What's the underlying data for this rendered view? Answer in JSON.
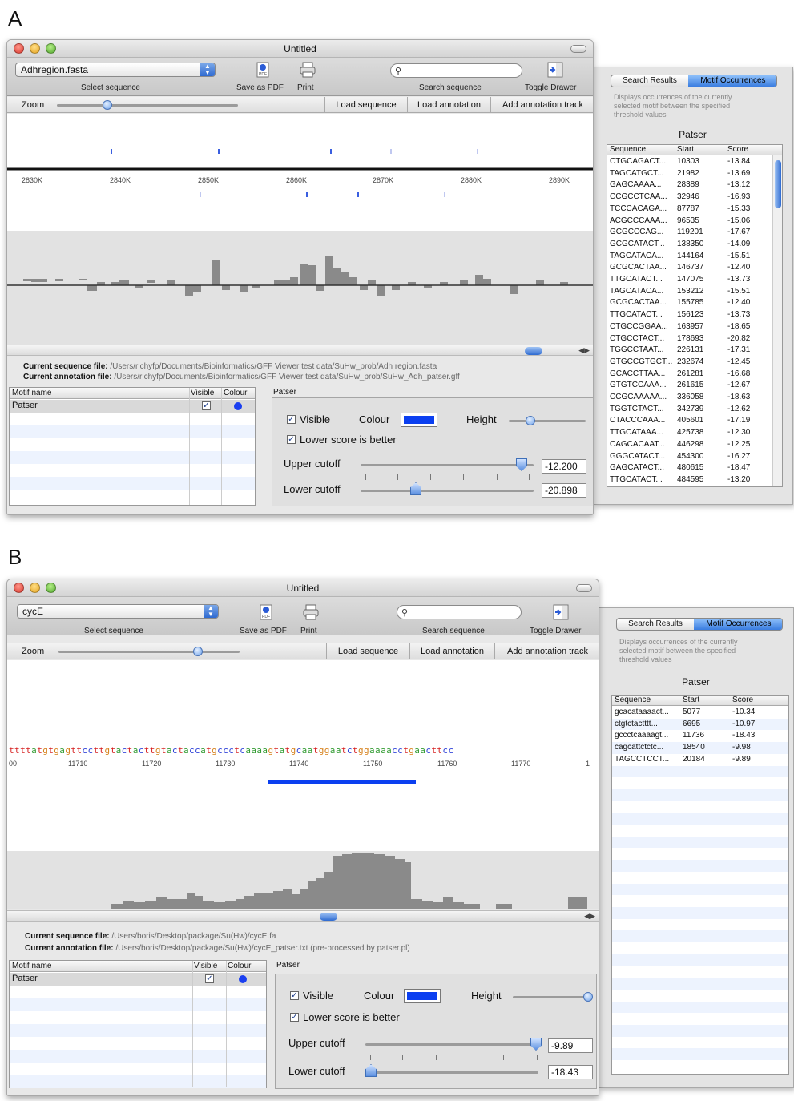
{
  "panel_labels": [
    "A",
    "B"
  ],
  "colors": {
    "motif_colour": "#0b3ff0",
    "track_tick": "#3a5fe0",
    "nuc_a": "#2f9a2f",
    "nuc_c": "#2c3fd8",
    "nuc_g": "#d6801a",
    "nuc_t": "#d62020"
  },
  "A": {
    "window_title": "Untitled",
    "sequence_select": "Adhregion.fasta",
    "select_sequence_label": "Select sequence",
    "save_pdf_label": "Save as PDF",
    "print_label": "Print",
    "search_label": "Search sequence",
    "toggle_drawer_label": "Toggle Drawer",
    "zoom_label": "Zoom",
    "zoom_level": 0.28,
    "load_sequence": "Load sequence",
    "load_annotation": "Load annotation",
    "add_track": "Add annotation track",
    "axis_ticks": [
      "2830K",
      "2840K",
      "2850K",
      "2860K",
      "2870K",
      "2880K",
      "2890K"
    ],
    "current_sequence_label": "Current sequence file:",
    "current_sequence_path": "/Users/richyfp/Documents/Bioinformatics/GFF Viewer test data/SuHw_prob/Adh region.fasta",
    "current_annotation_label": "Current annotation file:",
    "current_annotation_path": "/Users/richyfp/Documents/Bioinformatics/GFF Viewer test data/SuHw_prob/SuHw_Adh_patser.gff",
    "motif_headers": [
      "Motif name",
      "Visible",
      "Colour"
    ],
    "motif_rows": [
      {
        "name": "Patser"
      }
    ],
    "patser_title": "Patser",
    "visible_label": "Visible",
    "colour_label": "Colour",
    "height_label": "Height",
    "lower_better_label": "Lower score is better",
    "upper_cutoff_label": "Upper cutoff",
    "upper_cutoff_value": "-12.200",
    "lower_cutoff_label": "Lower cutoff",
    "lower_cutoff_value": "-20.898",
    "drawer": {
      "tab_search": "Search Results",
      "tab_motif": "Motif Occurrences",
      "description": [
        "Displays occurrences of the currently",
        "selected motif between the specified",
        "threshold values"
      ],
      "title": "Patser",
      "headers": [
        "Sequence",
        "Start",
        "Score"
      ],
      "rows": [
        [
          "CTGCAGACT...",
          "10303",
          "-13.84"
        ],
        [
          "TAGCATGCT...",
          "21982",
          "-13.69"
        ],
        [
          "GAGCAAAA...",
          "28389",
          "-13.12"
        ],
        [
          "CCGCCTCAA...",
          "32946",
          "-16.93"
        ],
        [
          "TCCCACAGA...",
          "87787",
          "-15.33"
        ],
        [
          "ACGCCCAAA...",
          "96535",
          "-15.06"
        ],
        [
          "GCGCCCAG...",
          "119201",
          "-17.67"
        ],
        [
          "GCGCATACT...",
          "138350",
          "-14.09"
        ],
        [
          "TAGCATACA...",
          "144164",
          "-15.51"
        ],
        [
          "GCGCACTAA...",
          "146737",
          "-12.40"
        ],
        [
          "TTGCATACT...",
          "147075",
          "-13.73"
        ],
        [
          "TAGCATACA...",
          "153212",
          "-15.51"
        ],
        [
          "GCGCACTAA...",
          "155785",
          "-12.40"
        ],
        [
          "TTGCATACT...",
          "156123",
          "-13.73"
        ],
        [
          "CTGCCGGAA...",
          "163957",
          "-18.65"
        ],
        [
          "CTGCCTACT...",
          "178693",
          "-20.82"
        ],
        [
          "TGGCCTAAT...",
          "226131",
          "-17.31"
        ],
        [
          "GTGCCGTGCT...",
          "232674",
          "-12.45"
        ],
        [
          "GCACCTTAA...",
          "261281",
          "-16.68"
        ],
        [
          "GTGTCCAAA...",
          "261615",
          "-12.67"
        ],
        [
          "CCGCAAAAA...",
          "336058",
          "-18.63"
        ],
        [
          "TGGTCTACT...",
          "342739",
          "-12.62"
        ],
        [
          "CTACCCAAA...",
          "405601",
          "-17.19"
        ],
        [
          "TTGCATAAA...",
          "425738",
          "-12.30"
        ],
        [
          "CAGCACAAT...",
          "446298",
          "-12.25"
        ],
        [
          "GGGCATACT...",
          "454300",
          "-16.27"
        ],
        [
          "GAGCATACT...",
          "480615",
          "-18.47"
        ],
        [
          "TTGCATACT...",
          "484595",
          "-13.20"
        ]
      ]
    }
  },
  "B": {
    "window_title": "Untitled",
    "sequence_select": "cycE",
    "select_sequence_label": "Select sequence",
    "save_pdf_label": "Save as PDF",
    "print_label": "Print",
    "search_label": "Search sequence",
    "toggle_drawer_label": "Toggle Drawer",
    "zoom_label": "Zoom",
    "zoom_level": 0.77,
    "load_sequence": "Load sequence",
    "load_annotation": "Load annotation",
    "add_track": "Add annotation track",
    "sequence": "ttttatgtgagttccttgtactacttgtactaccatgccctcaaaagtatgcaatggaatctggaaaacctgaacttcc",
    "axis_ticks": [
      "00",
      "11710",
      "11720",
      "11730",
      "11740",
      "11750",
      "11760",
      "11770",
      "1"
    ],
    "current_sequence_label": "Current sequence file:",
    "current_sequence_path": "/Users/boris/Desktop/package/Su(Hw)/cycE.fa",
    "current_annotation_label": "Current annotation file:",
    "current_annotation_path": "/Users/boris/Desktop/package/Su(Hw)/cycE_patser.txt (pre-processed by patser.pl)",
    "motif_headers": [
      "Motif name",
      "Visible",
      "Colour"
    ],
    "motif_rows": [
      {
        "name": "Patser"
      }
    ],
    "patser_title": "Patser",
    "visible_label": "Visible",
    "colour_label": "Colour",
    "height_label": "Height",
    "lower_better_label": "Lower score is better",
    "upper_cutoff_label": "Upper cutoff",
    "upper_cutoff_value": "-9.89",
    "lower_cutoff_label": "Lower cutoff",
    "lower_cutoff_value": "-18.43",
    "drawer": {
      "tab_search": "Search Results",
      "tab_motif": "Motif Occurrences",
      "description": [
        "Displays occurrences of the currently",
        "selected motif between the specified",
        "threshold values"
      ],
      "title": "Patser",
      "headers": [
        "Sequence",
        "Start",
        "Score"
      ],
      "rows": [
        [
          "gcacataaaact...",
          "5077",
          "-10.34"
        ],
        [
          "ctgtctactttt...",
          "6695",
          "-10.97"
        ],
        [
          "gccctcaaaagt...",
          "11736",
          "-18.43"
        ],
        [
          "cagcattctctc...",
          "18540",
          "-9.98"
        ],
        [
          "TAGCCTCCT...",
          "20184",
          "-9.89"
        ]
      ]
    }
  }
}
